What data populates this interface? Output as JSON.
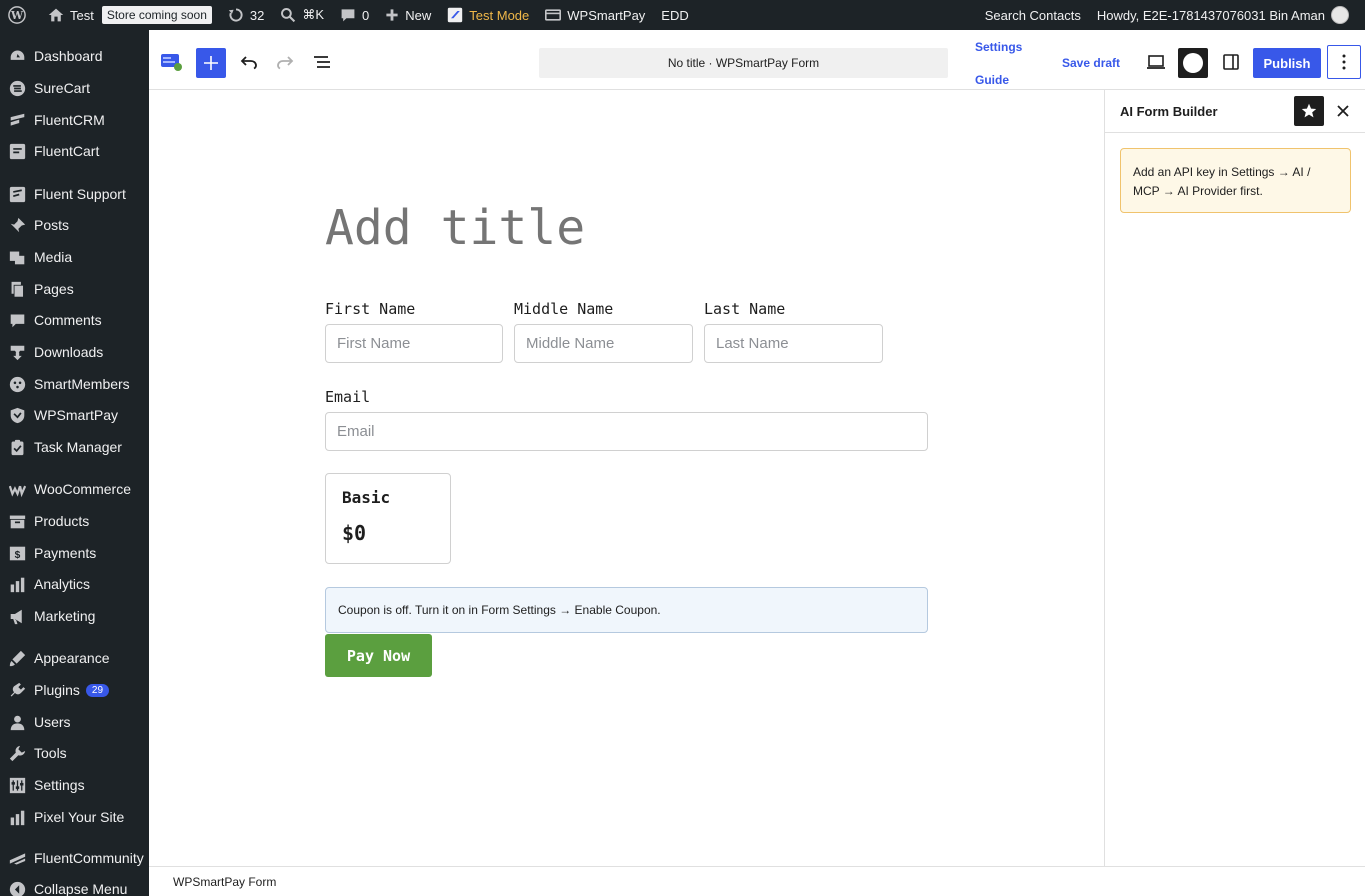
{
  "admin_bar": {
    "site_name": "Test",
    "store_badge": "Store coming soon",
    "updates_count": "32",
    "search_shortcut": "⌘K",
    "comments_count": "0",
    "new_label": "New",
    "test_mode_label": "Test Mode",
    "wpsmartpay_label": "WPSmartPay",
    "edd_label": "EDD",
    "search_contacts": "Search Contacts",
    "howdy": "Howdy, E2E-1781437076031 Bin Aman"
  },
  "sidebar": {
    "items": [
      {
        "label": "Dashboard",
        "icon": "dashboard-icon"
      },
      {
        "label": "SureCart",
        "icon": "surecart-icon"
      },
      {
        "label": "FluentCRM",
        "icon": "fluentcrm-icon"
      },
      {
        "label": "FluentCart",
        "icon": "fluentcart-icon"
      },
      {
        "label": "Fluent Support",
        "icon": "fluent-support-icon"
      },
      {
        "label": "Posts",
        "icon": "pin-icon"
      },
      {
        "label": "Media",
        "icon": "media-icon"
      },
      {
        "label": "Pages",
        "icon": "pages-icon"
      },
      {
        "label": "Comments",
        "icon": "comments-icon"
      },
      {
        "label": "Downloads",
        "icon": "download-icon"
      },
      {
        "label": "SmartMembers",
        "icon": "smartmembers-icon"
      },
      {
        "label": "WPSmartPay",
        "icon": "wpsmartpay-icon"
      },
      {
        "label": "Task Manager",
        "icon": "task-manager-icon"
      },
      {
        "label": "WooCommerce",
        "icon": "woocommerce-icon"
      },
      {
        "label": "Products",
        "icon": "products-icon"
      },
      {
        "label": "Payments",
        "icon": "payments-icon"
      },
      {
        "label": "Analytics",
        "icon": "analytics-icon"
      },
      {
        "label": "Marketing",
        "icon": "megaphone-icon"
      },
      {
        "label": "Appearance",
        "icon": "appearance-icon"
      },
      {
        "label": "Plugins",
        "icon": "plugins-icon",
        "badge": "29"
      },
      {
        "label": "Users",
        "icon": "users-icon"
      },
      {
        "label": "Tools",
        "icon": "wrench-icon"
      },
      {
        "label": "Settings",
        "icon": "settings-icon"
      },
      {
        "label": "Pixel Your Site",
        "icon": "pixel-icon"
      },
      {
        "label": "FluentCommunity",
        "icon": "fluentcommunity-icon"
      },
      {
        "label": "Collapse Menu",
        "icon": "collapse-icon"
      }
    ]
  },
  "header": {
    "doc_title": "No title · WPSmartPay Form",
    "settings_label": "Settings",
    "guide_label": "Guide",
    "save_draft_label": "Save draft",
    "publish_label": "Publish"
  },
  "form": {
    "title_placeholder": "Add title",
    "first_name_label": "First Name",
    "first_name_placeholder": "First Name",
    "middle_name_label": "Middle Name",
    "middle_name_placeholder": "Middle Name",
    "last_name_label": "Last Name",
    "last_name_placeholder": "Last Name",
    "email_label": "Email",
    "email_placeholder": "Email",
    "plan_name": "Basic",
    "plan_price": "$0",
    "coupon_note": "Coupon is off. Turn it on in Form Settings → Enable Coupon.",
    "pay_button": "Pay Now"
  },
  "ai_panel": {
    "title": "AI Form Builder",
    "notice": "Add an API key in Settings → AI / MCP → AI Provider first."
  },
  "footer": {
    "breadcrumb": "WPSmartPay Form"
  },
  "colors": {
    "admin_bg": "#1d2327",
    "accent": "#3858e9",
    "pay_green": "#5b9f3f",
    "test_mode": "#f0b849"
  }
}
